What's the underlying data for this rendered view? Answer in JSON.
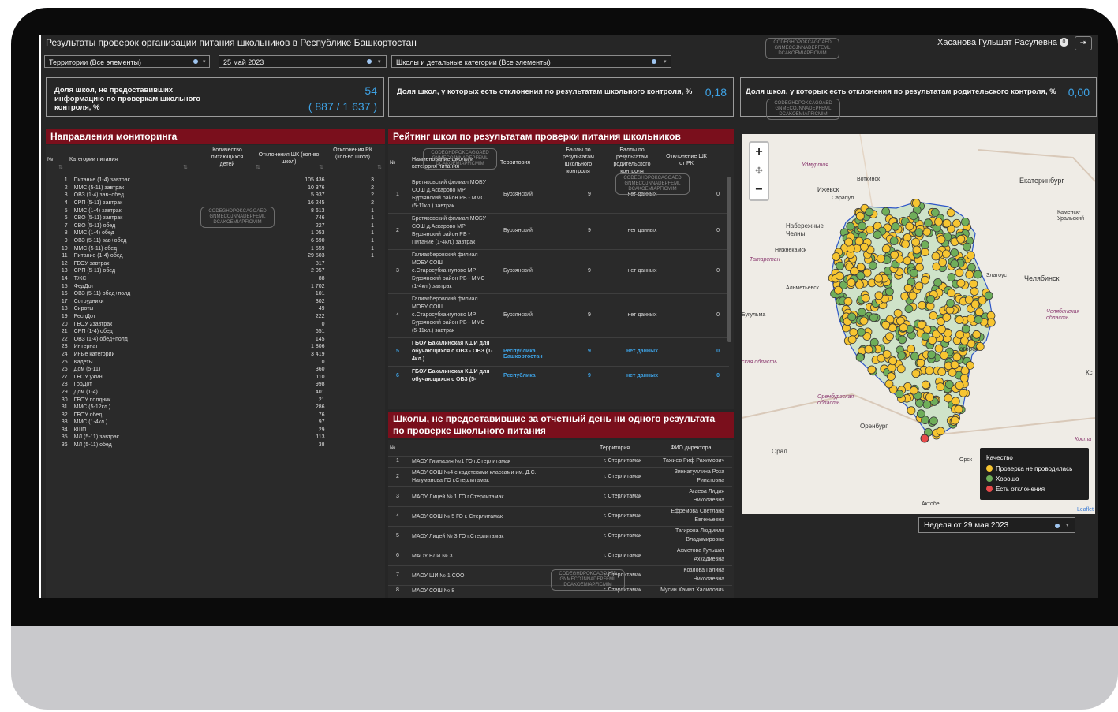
{
  "app": {
    "title": "Результаты проверок организации питания школьников в Республике Башкортостан",
    "user": "Хасанова Гульшат Расулевна",
    "notif_count": "0",
    "logout_icon": "logout-icon"
  },
  "filters": {
    "territory": "Территории (Все элементы)",
    "date": "25 май 2023",
    "schools": "Школы и детальные категории (Все элементы)",
    "week": "Неделя от 29 мая 2023"
  },
  "watermark": "CODEGHDPOKCAGOAED GNMECOJNNADEPFEML DCAKOEMIAPFICMIM",
  "kpi": {
    "k1_label": "Доля школ, не предоставивших информацию по проверкам школьного контроля, %",
    "k1_value": "54",
    "k1_sub": "( 887 / 1 637 )",
    "k2_label": "Доля школ, у которых есть отклонения по результатам школьного контроля, %",
    "k2_value": "0,18",
    "k3_label": "Доля школ, у которых есть отклонения по результатам родительского контроля, %",
    "k3_value": "0,00"
  },
  "directions": {
    "title": "Направления мониторинга",
    "col_no": "№",
    "col_cat": "Категории питания",
    "col_count": "Количество питающихся детей",
    "col_shk": "Отклонения ШК (кол-во школ)",
    "col_rk": "Отклонения РК (кол-во школ)",
    "rows": [
      {
        "n": "1",
        "cat": "Питание (1-4) завтрак",
        "count": "105 436",
        "shk": "3"
      },
      {
        "n": "2",
        "cat": "ММС (5-11) завтрак",
        "count": "10 376",
        "shk": "2"
      },
      {
        "n": "3",
        "cat": "ОВЗ (1-4) зав+обед",
        "count": "5 937",
        "shk": "2"
      },
      {
        "n": "4",
        "cat": "СРП (5-11) завтрак",
        "count": "16 245",
        "shk": "2"
      },
      {
        "n": "5",
        "cat": "ММС (1-4) завтрак",
        "count": "8 613",
        "shk": "1"
      },
      {
        "n": "6",
        "cat": "СВО (5-11) завтрак",
        "count": "746",
        "shk": "1"
      },
      {
        "n": "7",
        "cat": "СВО (5-11) обед",
        "count": "227",
        "shk": "1"
      },
      {
        "n": "8",
        "cat": "ММС (1-4) обед",
        "count": "1 053",
        "shk": "1"
      },
      {
        "n": "9",
        "cat": "ОВЗ (5-11) зав+обед",
        "count": "6 690",
        "shk": "1"
      },
      {
        "n": "10",
        "cat": "ММС (5-11) обед",
        "count": "1 559",
        "shk": "1"
      },
      {
        "n": "11",
        "cat": "Питание (1-4) обед",
        "count": "29 503",
        "shk": "1"
      },
      {
        "n": "12",
        "cat": "ГБОУ завтрак",
        "count": "817",
        "shk": ""
      },
      {
        "n": "13",
        "cat": "СРП (5-11) обед",
        "count": "2 057",
        "shk": ""
      },
      {
        "n": "14",
        "cat": "ТЖС",
        "count": "88",
        "shk": ""
      },
      {
        "n": "15",
        "cat": "ФедДот",
        "count": "1 702",
        "shk": ""
      },
      {
        "n": "16",
        "cat": "ОВЗ (5-11) обед+полд",
        "count": "101",
        "shk": ""
      },
      {
        "n": "17",
        "cat": "Сотрудники",
        "count": "302",
        "shk": ""
      },
      {
        "n": "18",
        "cat": "Сироты",
        "count": "49",
        "shk": ""
      },
      {
        "n": "19",
        "cat": "РеспДот",
        "count": "222",
        "shk": ""
      },
      {
        "n": "20",
        "cat": "ГБОУ 2завтрак",
        "count": "0",
        "shk": ""
      },
      {
        "n": "21",
        "cat": "СРП (1-4) обед",
        "count": "651",
        "shk": ""
      },
      {
        "n": "22",
        "cat": "ОВЗ (1-4) обед+полд",
        "count": "145",
        "shk": ""
      },
      {
        "n": "23",
        "cat": "Интернат",
        "count": "1 806",
        "shk": ""
      },
      {
        "n": "24",
        "cat": "Иные категории",
        "count": "3 419",
        "shk": ""
      },
      {
        "n": "25",
        "cat": "Кадеты",
        "count": "0",
        "shk": ""
      },
      {
        "n": "26",
        "cat": "Дом (5-11)",
        "count": "360",
        "shk": ""
      },
      {
        "n": "27",
        "cat": "ГБОУ ужин",
        "count": "110",
        "shk": ""
      },
      {
        "n": "28",
        "cat": "ГорДот",
        "count": "998",
        "shk": ""
      },
      {
        "n": "29",
        "cat": "Дом (1-4)",
        "count": "401",
        "shk": ""
      },
      {
        "n": "30",
        "cat": "ГБОУ полдник",
        "count": "21",
        "shk": ""
      },
      {
        "n": "31",
        "cat": "ММС (5-12кл.)",
        "count": "286",
        "shk": ""
      },
      {
        "n": "32",
        "cat": "ГБОУ обед",
        "count": "76",
        "shk": ""
      },
      {
        "n": "33",
        "cat": "ММС (1-4кл.)",
        "count": "97",
        "shk": ""
      },
      {
        "n": "34",
        "cat": "КШП",
        "count": "29",
        "shk": ""
      },
      {
        "n": "35",
        "cat": "МЛ (5-11) завтрак",
        "count": "113",
        "shk": ""
      },
      {
        "n": "36",
        "cat": "МЛ (5-11) обед",
        "count": "38",
        "shk": ""
      }
    ]
  },
  "rating": {
    "title": "Рейтинг школ по результатам проверки питания школьников",
    "col_no": "№",
    "col_name": "Наименование школы и категория питания",
    "col_terr": "Территория",
    "col_shk": "Баллы по результатам школьного контроля",
    "col_rk": "Баллы по результатам родительского контроля",
    "col_dev": "Отклонение ШК от РК",
    "rows": [
      {
        "n": "1",
        "name": [
          "Бретяковский филиал МОБУ",
          "СОШ д.Аскарово МР",
          "Бурзянский район РБ - ММС",
          "(5-11кл.) завтрак"
        ],
        "terr": "Бурзянский",
        "shk": "9",
        "rk": "нет данных",
        "dev": "0"
      },
      {
        "n": "2",
        "name": [
          "Бретяковский филиал МОБУ",
          "СОШ д.Аскарово МР",
          "Бурзянский район РБ -",
          "Питание (1-4кл.) завтрак"
        ],
        "terr": "Бурзянский",
        "shk": "9",
        "rk": "нет данных",
        "dev": "0"
      },
      {
        "n": "3",
        "name": [
          "Галиакберовский филиал",
          "МОБУ СОШ",
          "с.Старосубхангулово МР",
          "Бурзянский район РБ - ММС",
          "(1-4кл.) завтрак"
        ],
        "terr": "Бурзянский",
        "shk": "9",
        "rk": "нет данных",
        "dev": "0"
      },
      {
        "n": "4",
        "name": [
          "Галиакберовский филиал",
          "МОБУ СОШ",
          "с.Старосубхангулово МР",
          "Бурзянский район РБ - ММС",
          "(5-11кл.) завтрак"
        ],
        "terr": "Бурзянский",
        "shk": "9",
        "rk": "нет данных",
        "dev": "0"
      },
      {
        "n": "5",
        "name": [
          "ГБОУ Бакалинская КШИ для",
          "обучающихся с ОВЗ - ОВЗ (1-",
          "4кл.)"
        ],
        "terr": "Республика Башкортостан",
        "shk": "9",
        "rk": "нет данных",
        "dev": "0"
      },
      {
        "n": "6",
        "name": [
          "ГБОУ Бакалинская КШИ для",
          "обучающихся с ОВЗ (5-"
        ],
        "terr": "Республика",
        "shk": "9",
        "rk": "нет данных",
        "dev": "0"
      }
    ]
  },
  "noresult": {
    "title": "Школы, не предоставившие за отчетный день ни одного результата по проверке школьного питания",
    "col_no": "№",
    "col_terr": "Территория",
    "col_dir": "ФИО директора",
    "rows": [
      {
        "n": "1",
        "name": "МАОУ Гимназия №1 ГО г.Стерлитамак",
        "terr": "г. Стерлитамак",
        "dir": [
          "Тажиев Риф Рахимович"
        ]
      },
      {
        "n": "2",
        "name": "МАОУ СОШ №4 с кадетскими классами им. Д.С. Нагуманова ГО г.Стерлитамак",
        "terr": "г. Стерлитамак",
        "dir": [
          "Зиннатуллина Роза",
          "Ринатовна"
        ]
      },
      {
        "n": "3",
        "name": "МАОУ Лицей № 1 ГО г.Стерлитамак",
        "terr": "г. Стерлитамак",
        "dir": [
          "Агаева Лидия",
          "Николаевна"
        ]
      },
      {
        "n": "4",
        "name": "МАОУ СОШ № 5 ГО г. Стерлитамак",
        "terr": "г. Стерлитамак",
        "dir": [
          "Ефремова Светлана",
          "Евгеньевна"
        ]
      },
      {
        "n": "5",
        "name": "МАОУ Лицей № 3 ГО г.Стерлитамак",
        "terr": "г. Стерлитамак",
        "dir": [
          "Тагирова Людмила",
          "Владимировна"
        ]
      },
      {
        "n": "6",
        "name": "МАОУ БЛИ № 3",
        "terr": "г. Стерлитамак",
        "dir": [
          "Ахметова Гульшат",
          "Ахкадиевна"
        ]
      },
      {
        "n": "7",
        "name": "МАОУ ШИ № 1 СОО",
        "terr": "г. Стерлитамак",
        "dir": [
          "Козлова Галина",
          "Николаевна"
        ]
      },
      {
        "n": "8",
        "name": "МАОУ СОШ № 8",
        "terr": "г. Стерлитамак",
        "dir": [
          "Мусин Хамит Халилович"
        ]
      }
    ]
  },
  "map": {
    "zoom_in": "+",
    "zoom_move": "✣",
    "zoom_out": "−",
    "attribution": "Leaflet",
    "cities": [
      {
        "name": "Ижевск"
      },
      {
        "name": "Воткинск"
      },
      {
        "name": "Екатеринбург"
      },
      {
        "name": "Сарапул"
      },
      {
        "name": "Набережные Челны"
      },
      {
        "name": "Каменск-Уральский"
      },
      {
        "name": "Нижнекамск"
      },
      {
        "name": "Альметьевск"
      },
      {
        "name": "Златоуст"
      },
      {
        "name": "Челябинск"
      },
      {
        "name": "Бугульма"
      },
      {
        "name": "огорск"
      },
      {
        "name": "Оренбург"
      },
      {
        "name": "Орск"
      },
      {
        "name": "Орал"
      },
      {
        "name": "Актобе"
      },
      {
        "name": "Кс"
      },
      {
        "name": "Удмуртия"
      },
      {
        "name": "Татарстан"
      },
      {
        "name": "Челябинская область"
      },
      {
        "name": "Оренбургская область"
      },
      {
        "name": "ская область"
      },
      {
        "name": "Коста"
      }
    ],
    "legend": {
      "title": "Качество",
      "items": [
        {
          "label": "Проверка не проводилась",
          "color": "#f7c531"
        },
        {
          "label": "Хорошо",
          "color": "#6fae5a"
        },
        {
          "label": "Есть отклонения",
          "color": "#e84a4a"
        }
      ]
    }
  },
  "colors": {
    "accent": "#3ea3e6",
    "header_red": "#7a0f1c"
  }
}
